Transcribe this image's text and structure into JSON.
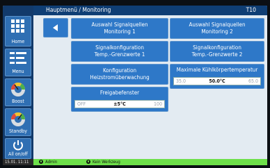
{
  "header": {
    "title": "Hauptmenü / Monitoring",
    "code": "T10"
  },
  "sidebar": {
    "items": [
      {
        "label": "Home",
        "icon": "home-grid-icon"
      },
      {
        "label": "Menu",
        "icon": "menu-icon"
      },
      {
        "label": "Boost",
        "icon": "gauge-icon"
      },
      {
        "label": "Standby",
        "icon": "gauge-icon"
      },
      {
        "label": "All on/off",
        "icon": "power-icon"
      }
    ]
  },
  "tiles": {
    "signal1": {
      "line1": "Auswahl Signalquellen",
      "line2": "Monitoring 1"
    },
    "signal2": {
      "line1": "Auswahl Signalquellen",
      "line2": "Monitoring 2"
    },
    "config1": {
      "line1": "Signalkonfiguration",
      "line2": "Temp.-Grenzwerte 1"
    },
    "config2": {
      "line1": "Signalkonfiguration",
      "line2": "Temp.-Grenzwerte 2"
    },
    "heat": {
      "line1": "Konfiguration",
      "line2": "Heizstromüberwachung"
    }
  },
  "max_temp": {
    "label": "Maximale Kühlkörpertemperatur",
    "min": "35.0",
    "value": "50.0°C",
    "max": "65.0"
  },
  "release": {
    "label": "Freigabefenster",
    "min": "OFF",
    "value": "±5°C",
    "max": "100"
  },
  "status": {
    "date": "15.01. 11:11",
    "user": "Admin",
    "tool": "Kein Werkzeug"
  },
  "colors": {
    "tile": "#2e78c8",
    "sidebar": "#123a6b",
    "header": "#0f3e74",
    "status": "#6ee04a"
  }
}
